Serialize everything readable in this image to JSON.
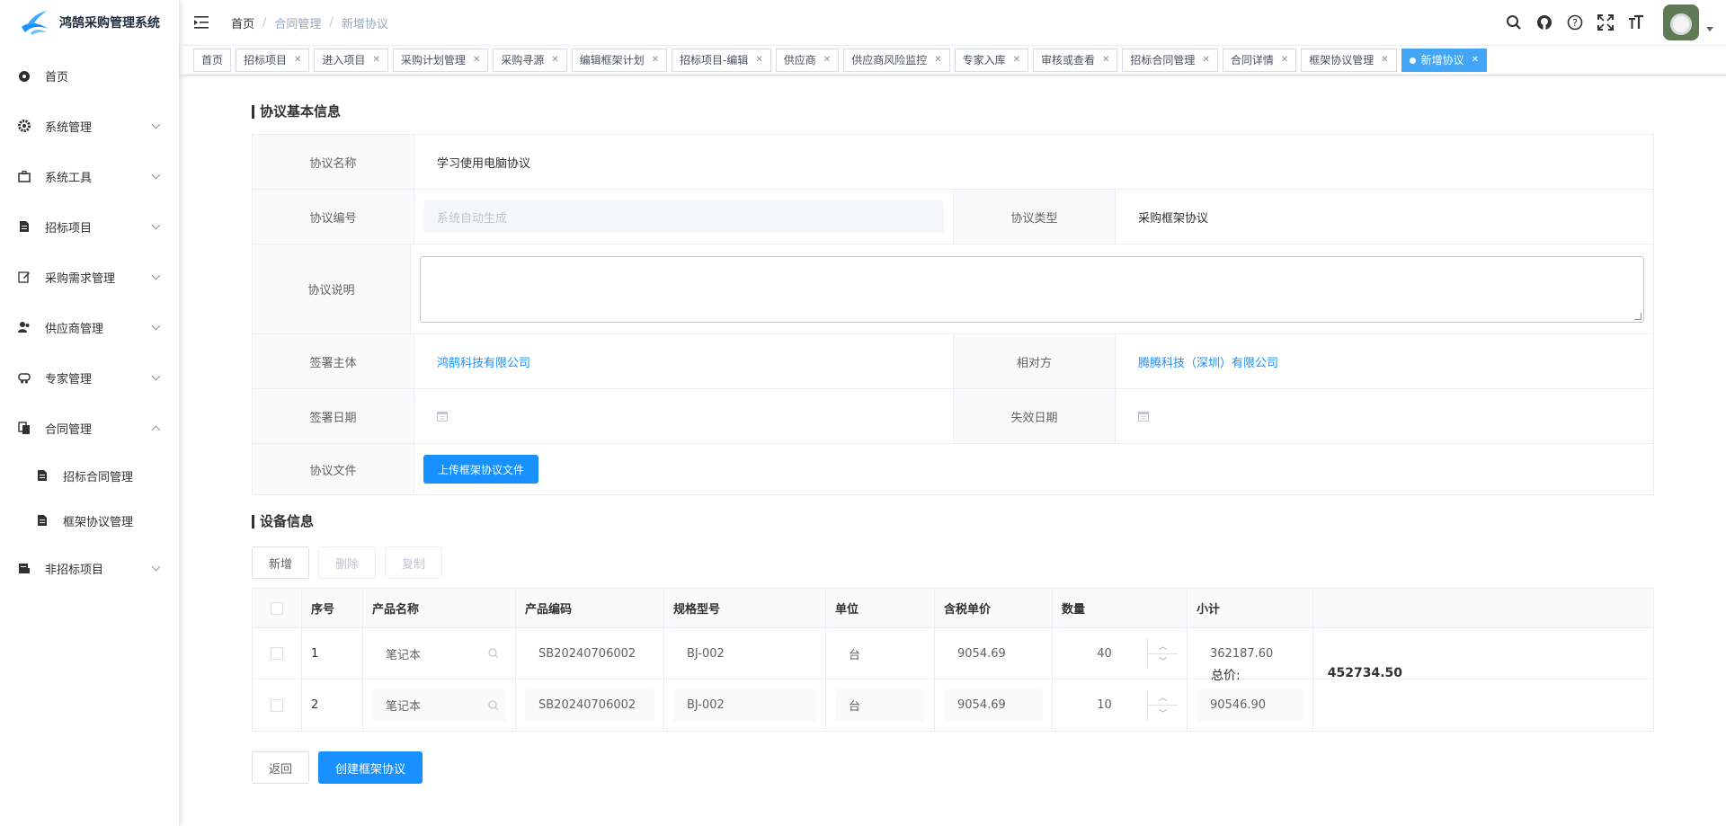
{
  "app": {
    "title": "鸿鹄采购管理系统"
  },
  "sidebar": {
    "items": [
      {
        "label": "首页",
        "icon": "dashboard-icon",
        "expandable": false
      },
      {
        "label": "系统管理",
        "icon": "gear-icon",
        "expandable": true
      },
      {
        "label": "系统工具",
        "icon": "toolbox-icon",
        "expandable": true
      },
      {
        "label": "招标项目",
        "icon": "document-icon",
        "expandable": true
      },
      {
        "label": "采购需求管理",
        "icon": "edit-icon",
        "expandable": true
      },
      {
        "label": "供应商管理",
        "icon": "users-icon",
        "expandable": true
      },
      {
        "label": "专家管理",
        "icon": "expert-icon",
        "expandable": true
      },
      {
        "label": "合同管理",
        "icon": "contract-icon",
        "expandable": true,
        "expanded": true
      },
      {
        "label": "非招标项目",
        "icon": "folder-icon",
        "expandable": true
      }
    ],
    "contract_sub": [
      {
        "label": "招标合同管理"
      },
      {
        "label": "框架协议管理"
      }
    ]
  },
  "header": {
    "breadcrumb": [
      "首页",
      "合同管理",
      "新增协议"
    ]
  },
  "tags": [
    {
      "label": "首页",
      "closable": false
    },
    {
      "label": "招标项目",
      "closable": true
    },
    {
      "label": "进入项目",
      "closable": true
    },
    {
      "label": "采购计划管理",
      "closable": true
    },
    {
      "label": "采购寻源",
      "closable": true
    },
    {
      "label": "编辑框架计划",
      "closable": true
    },
    {
      "label": "招标项目-编辑",
      "closable": true
    },
    {
      "label": "供应商",
      "closable": true
    },
    {
      "label": "供应商风险监控",
      "closable": true
    },
    {
      "label": "专家入库",
      "closable": true
    },
    {
      "label": "审核或查看",
      "closable": true
    },
    {
      "label": "招标合同管理",
      "closable": true
    },
    {
      "label": "合同详情",
      "closable": true
    },
    {
      "label": "框架协议管理",
      "closable": true
    },
    {
      "label": "新增协议",
      "closable": true,
      "active": true
    }
  ],
  "basic": {
    "title": "协议基本信息",
    "name_label": "协议名称",
    "name_value": "学习使用电脑协议",
    "no_label": "协议编号",
    "no_placeholder": "系统自动生成",
    "type_label": "协议类型",
    "type_value": "采购框架协议",
    "desc_label": "协议说明",
    "party_label": "签署主体",
    "party_value": "鸿鹄科技有限公司",
    "counter_label": "相对方",
    "counter_value": "腾腾科技（深圳）有限公司",
    "sign_date_label": "签署日期",
    "expire_date_label": "失效日期",
    "file_label": "协议文件",
    "upload_button": "上传框架协议文件"
  },
  "equipment": {
    "title": "设备信息",
    "add_button": "新增",
    "delete_button": "删除",
    "copy_button": "复制",
    "columns": [
      "序号",
      "产品名称",
      "产品编码",
      "规格型号",
      "单位",
      "含税单价",
      "数量",
      "小计"
    ],
    "rows": [
      {
        "no": "1",
        "name": "笔记本",
        "code": "SB20240706002",
        "spec": "BJ-002",
        "unit": "台",
        "price": "9054.69",
        "qty": "40",
        "subtotal": "362187.60"
      },
      {
        "no": "2",
        "name": "笔记本",
        "code": "SB20240706002",
        "spec": "BJ-002",
        "unit": "台",
        "price": "9054.69",
        "qty": "10",
        "subtotal": "90546.90"
      }
    ],
    "total_label": "总价:",
    "total_value": "452734.50"
  },
  "footer": {
    "back_button": "返回",
    "create_button": "创建框架协议"
  },
  "colors": {
    "primary": "#1890ff",
    "link": "#1890ff",
    "active_tag": "#42a5f5"
  }
}
